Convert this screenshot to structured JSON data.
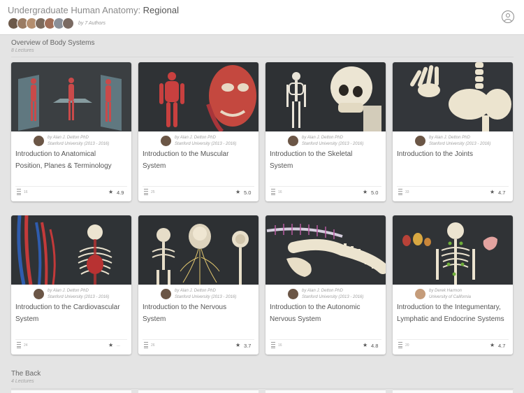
{
  "header": {
    "title_prefix": "Undergraduate Human Anatomy: ",
    "title_emphasis": "Regional",
    "authors_label": "by 7 Authors",
    "author_colors": [
      "#6d5a4a",
      "#9a7b62",
      "#b48e6e",
      "#7c6a5c",
      "#a06e58",
      "#8a8f98",
      "#7a6a62"
    ]
  },
  "sections": [
    {
      "title": "Overview of Body Systems",
      "subtitle": "8 Lectures"
    },
    {
      "title": "The Back",
      "subtitle": "4 Lectures"
    }
  ],
  "cards": [
    {
      "title_line1": "Introduction to Anatomical",
      "title_line2": "Position, Planes & Terminology",
      "instructor": "by Alan J. Detton PhD",
      "institution": "Stanford University (2013 - 2016)",
      "lectures": "16",
      "rating": "4.9",
      "thumb_icon": "anatomical-planes-thumbnail"
    },
    {
      "title_line1": "Introduction to the Muscular",
      "title_line2": "System",
      "instructor": "by Alan J. Detton PhD",
      "institution": "Stanford University (2013 - 2016)",
      "lectures": "25",
      "rating": "5.0",
      "thumb_icon": "muscular-system-thumbnail"
    },
    {
      "title_line1": "Introduction to the Skeletal",
      "title_line2": "System",
      "instructor": "by Alan J. Detton PhD",
      "institution": "Stanford University (2013 - 2016)",
      "lectures": "16",
      "rating": "5.0",
      "thumb_icon": "skeletal-system-thumbnail"
    },
    {
      "title_line1": "Introduction to the Joints",
      "title_line2": "",
      "instructor": "by Alan J. Detton PhD",
      "institution": "Stanford University (2013 - 2016)",
      "lectures": "33",
      "rating": "4.7",
      "thumb_icon": "joints-thumbnail"
    },
    {
      "title_line1": "Introduction to the Cardiovascular",
      "title_line2": "System",
      "instructor": "by Alan J. Detton PhD",
      "institution": "Stanford University (2013 - 2016)",
      "lectures": "24",
      "rating": "---",
      "thumb_icon": "cardiovascular-thumbnail"
    },
    {
      "title_line1": "Introduction to the Nervous",
      "title_line2": "System",
      "instructor": "by Alan J. Detton PhD",
      "institution": "Stanford University (2013 - 2016)",
      "lectures": "26",
      "rating": "3.7",
      "thumb_icon": "nervous-system-thumbnail"
    },
    {
      "title_line1": "Introduction to the Autonomic",
      "title_line2": "Nervous System",
      "instructor": "by Alan J. Detton PhD",
      "institution": "Stanford University (2013 - 2016)",
      "lectures": "16",
      "rating": "4.8",
      "thumb_icon": "autonomic-nervous-thumbnail"
    },
    {
      "title_line1": "Introduction to the Integumentary,",
      "title_line2": "Lymphatic and Endocrine Systems",
      "instructor": "by Derek Harmon",
      "institution": "University of California",
      "lectures": "20",
      "rating": "4.7",
      "thumb_icon": "integumentary-thumbnail"
    }
  ]
}
